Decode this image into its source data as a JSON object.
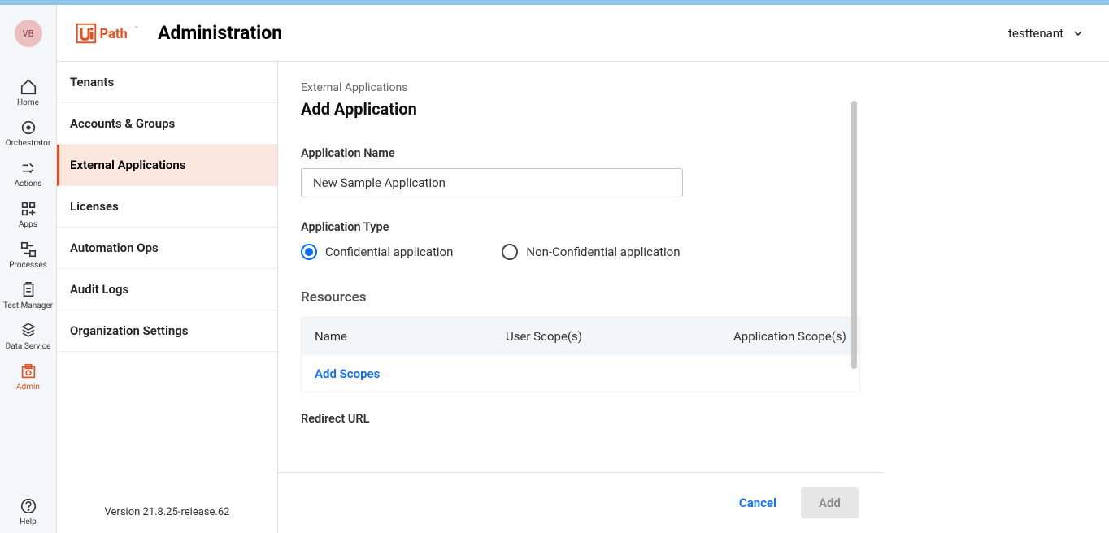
{
  "avatar_initials": "VB",
  "rail": {
    "items": [
      {
        "label": "Home"
      },
      {
        "label": "Orchestrator"
      },
      {
        "label": "Actions"
      },
      {
        "label": "Apps"
      },
      {
        "label": "Processes"
      },
      {
        "label": "Test Manager"
      },
      {
        "label": "Data Service"
      },
      {
        "label": "Admin"
      }
    ],
    "help_label": "Help"
  },
  "header": {
    "brand_ui": "Ui",
    "brand_path": "Path",
    "title": "Administration",
    "tenant": "testtenant"
  },
  "subnav": {
    "items": [
      "Tenants",
      "Accounts & Groups",
      "External Applications",
      "Licenses",
      "Automation Ops",
      "Audit Logs",
      "Organization Settings"
    ],
    "version": "Version 21.8.25-release.62"
  },
  "page": {
    "breadcrumb": "External Applications",
    "title": "Add Application",
    "app_name_label": "Application Name",
    "app_name_value": "New Sample Application",
    "app_type_label": "Application Type",
    "type_confidential": "Confidential application",
    "type_non_confidential": "Non-Confidential application",
    "resources_title": "Resources",
    "col_name": "Name",
    "col_user_scope": "User Scope(s)",
    "col_app_scope": "Application Scope(s)",
    "add_scopes": "Add Scopes",
    "redirect_url_label": "Redirect URL",
    "cancel": "Cancel",
    "add": "Add"
  }
}
